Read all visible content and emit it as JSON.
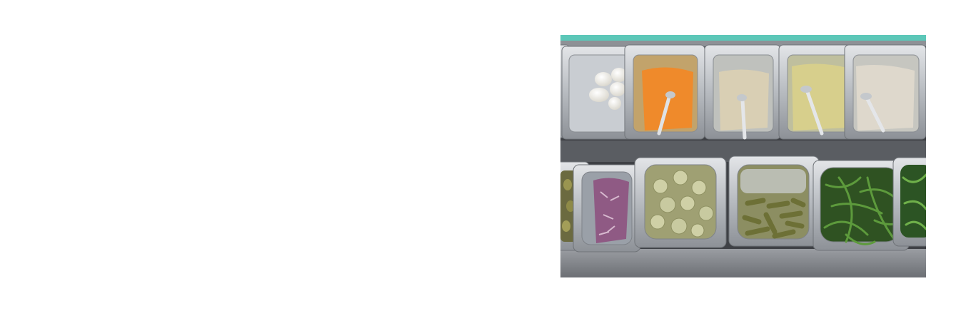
{
  "page": {
    "background": "#ffffff"
  },
  "photo": {
    "subject": "salad-bar-steel-containers",
    "palette": {
      "steel_light": "#cfd2d6",
      "steel_mid": "#a3a7ad",
      "steel_dark": "#55585e",
      "teal_edge": "#5cc7b8",
      "counter": "#7a7d83"
    },
    "trays": [
      {
        "id": "eggs",
        "row": 0,
        "fill": "#f3f1ea"
      },
      {
        "id": "carrot-salad",
        "row": 0,
        "fill": "#ef8a2b"
      },
      {
        "id": "creamy-salad-1",
        "row": 0,
        "fill": "#d9cfb4"
      },
      {
        "id": "potato-salad",
        "row": 0,
        "fill": "#d7cf8c"
      },
      {
        "id": "creamy-salad-2",
        "row": 0,
        "fill": "#ded8cc"
      },
      {
        "id": "olives-partial",
        "row": 1,
        "fill": "#8e8a47"
      },
      {
        "id": "red-cabbage",
        "row": 1,
        "fill": "#8f5a84"
      },
      {
        "id": "pickle-slices",
        "row": 1,
        "fill": "#9fa073"
      },
      {
        "id": "gherkins",
        "row": 1,
        "fill": "#6d7036"
      },
      {
        "id": "arugula",
        "row": 1,
        "fill": "#3e6b2b"
      },
      {
        "id": "greens-partial",
        "row": 1,
        "fill": "#3f7a33"
      }
    ]
  }
}
